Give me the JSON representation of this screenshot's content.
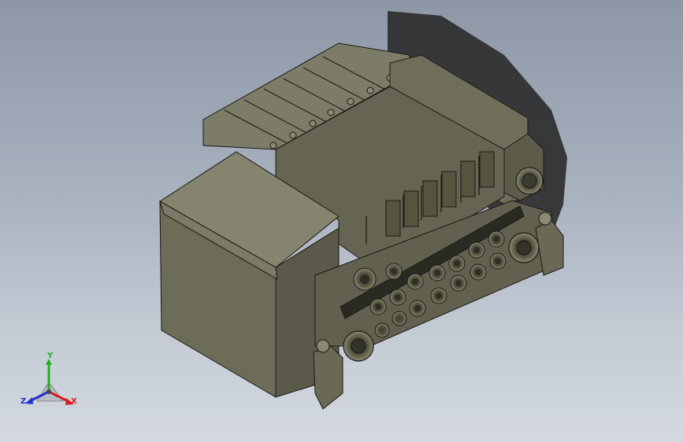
{
  "viewport": {
    "background_top": "#8d97a6",
    "background_bottom": "#d4d9e0"
  },
  "model": {
    "description_icon": "valve-manifold-3d-model",
    "body_color": "#6b6a58",
    "edge_color": "#1a1a14",
    "shadow_color": "#2a2a2a"
  },
  "triad": {
    "x_label": "X",
    "y_label": "Y",
    "z_label": "Z",
    "x_color": "#d42020",
    "y_color": "#1fb01f",
    "z_color": "#2030d0"
  }
}
